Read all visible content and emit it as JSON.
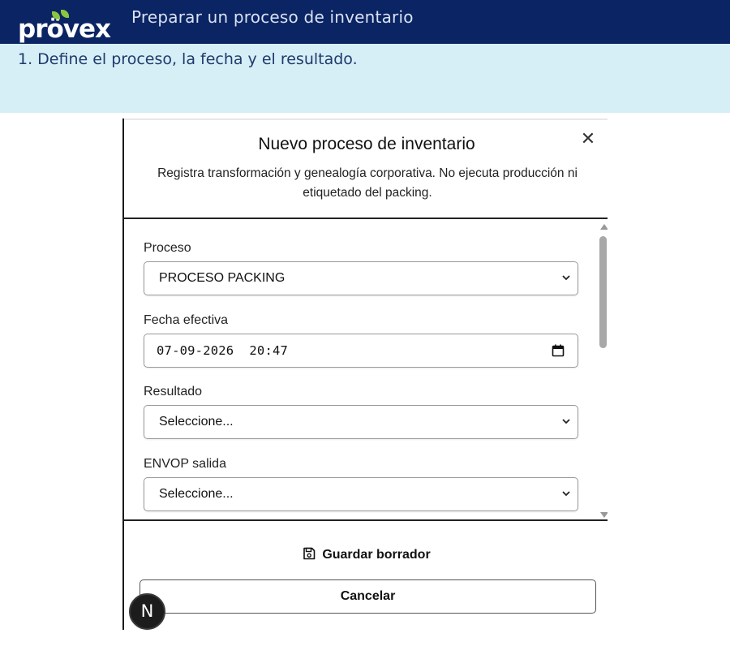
{
  "brand": {
    "logo_text": "prövex",
    "colors": {
      "navy": "#0b2463",
      "leaf": "#8cc63f",
      "band": "#d6eef6"
    }
  },
  "header": {
    "title": "Preparar un proceso de inventario"
  },
  "step": {
    "text": "1. Define el proceso, la fecha y el resultado."
  },
  "modal": {
    "title": "Nuevo proceso de inventario",
    "close_icon": "close-icon",
    "subtitle": "Registra transformación y genealogía corporativa. No ejecuta producción ni etiquetado del packing.",
    "fields": {
      "proceso": {
        "label": "Proceso",
        "value": "PROCESO PACKING"
      },
      "fecha": {
        "label": "Fecha efectiva",
        "value": "07-09-2026  20:47"
      },
      "resultado": {
        "label": "Resultado",
        "value": "Seleccione..."
      },
      "envop": {
        "label": "ENVOP salida",
        "value": "Seleccione..."
      }
    },
    "footer": {
      "save_draft_label": "Guardar borrador",
      "cancel_label": "Cancelar"
    }
  },
  "avatar": {
    "initial": "N"
  }
}
